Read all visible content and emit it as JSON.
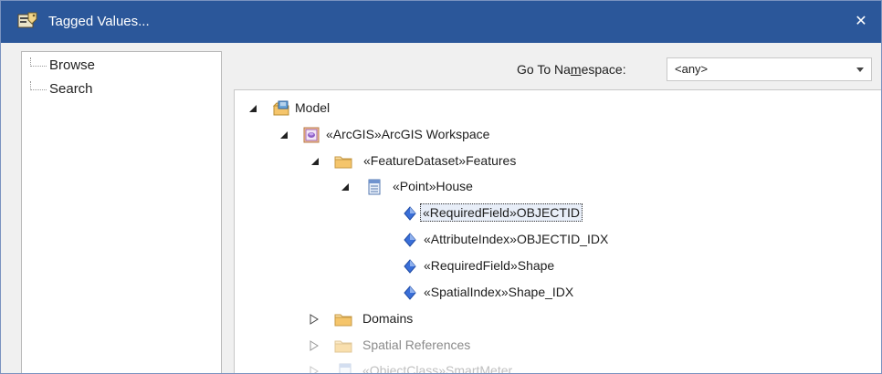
{
  "window": {
    "title": "Tagged Values...",
    "close": "✕"
  },
  "nav": {
    "items": [
      {
        "label": "Browse"
      },
      {
        "label": "Search"
      }
    ]
  },
  "namespace": {
    "label_before": "Go To Na",
    "label_underlined": "m",
    "label_after": "espace:",
    "value": "<any>"
  },
  "tree": {
    "model": "Model",
    "workspace": "«ArcGIS»ArcGIS Workspace",
    "features": "«FeatureDataset»Features",
    "house": "«Point»House",
    "fields": [
      "«RequiredField»OBJECTID",
      "«AttributeIndex»OBJECTID_IDX",
      "«RequiredField»Shape",
      "«SpatialIndex»Shape_IDX"
    ],
    "domains": "Domains",
    "spatial_refs": "Spatial References",
    "smartmeter": "«ObjectClass»SmartMeter"
  },
  "colors": {
    "titlebar": "#2b579a",
    "folder": "#f5c56b",
    "attribute_icon": "#3a6fd8"
  }
}
